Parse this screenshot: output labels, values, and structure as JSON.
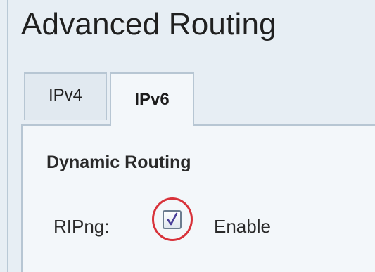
{
  "page": {
    "title": "Advanced Routing"
  },
  "tabs": [
    {
      "label": "IPv4",
      "active": false
    },
    {
      "label": "IPv6",
      "active": true
    }
  ],
  "section": {
    "heading": "Dynamic Routing",
    "ripng": {
      "label": "RIPng:",
      "checkbox_label": "Enable",
      "checked": true
    }
  },
  "colors": {
    "highlight_ring": "#d8323a",
    "check_mark": "#4a3f9a",
    "panel_background": "#e7eef4",
    "tab_border": "#b7c6d3"
  },
  "icons": {
    "check": "check-mark-icon"
  }
}
